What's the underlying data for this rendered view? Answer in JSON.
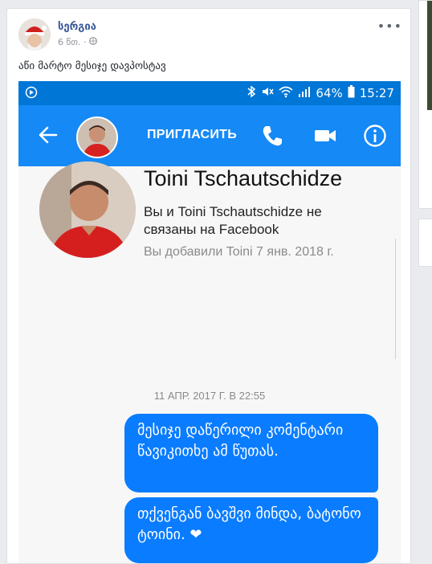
{
  "post": {
    "author": "სერგია",
    "time": "6 წთ.",
    "text": "აწი მარტო მესიჯე დავპოსტავ"
  },
  "screenshot": {
    "statusbar": {
      "battery": "64%",
      "time": "15:27"
    },
    "topbar": {
      "invite_label": "ПРИГЛАСИТЬ"
    },
    "profile": {
      "name": "Toini Tschautschidze",
      "connection_text": "Вы и Toini Tschautschidze не связаны на Facebook",
      "added_text": "Вы добавили Toini 7 янв. 2018 г."
    },
    "timestamp": "11 АПР. 2017 Г. В 22:55",
    "messages": [
      {
        "text": "მესიჯე დაწერილი კომენტარი წავიკითხე ამ წუთას."
      },
      {
        "text": "თქვენგან ბავშვი მინდა, ბატონო ტოინი. ❤"
      }
    ]
  },
  "colors": {
    "messenger_blue": "#1589f5",
    "bubble_blue": "#0a7cff",
    "status_blue": "#0076d6",
    "fb_link": "#385898"
  }
}
